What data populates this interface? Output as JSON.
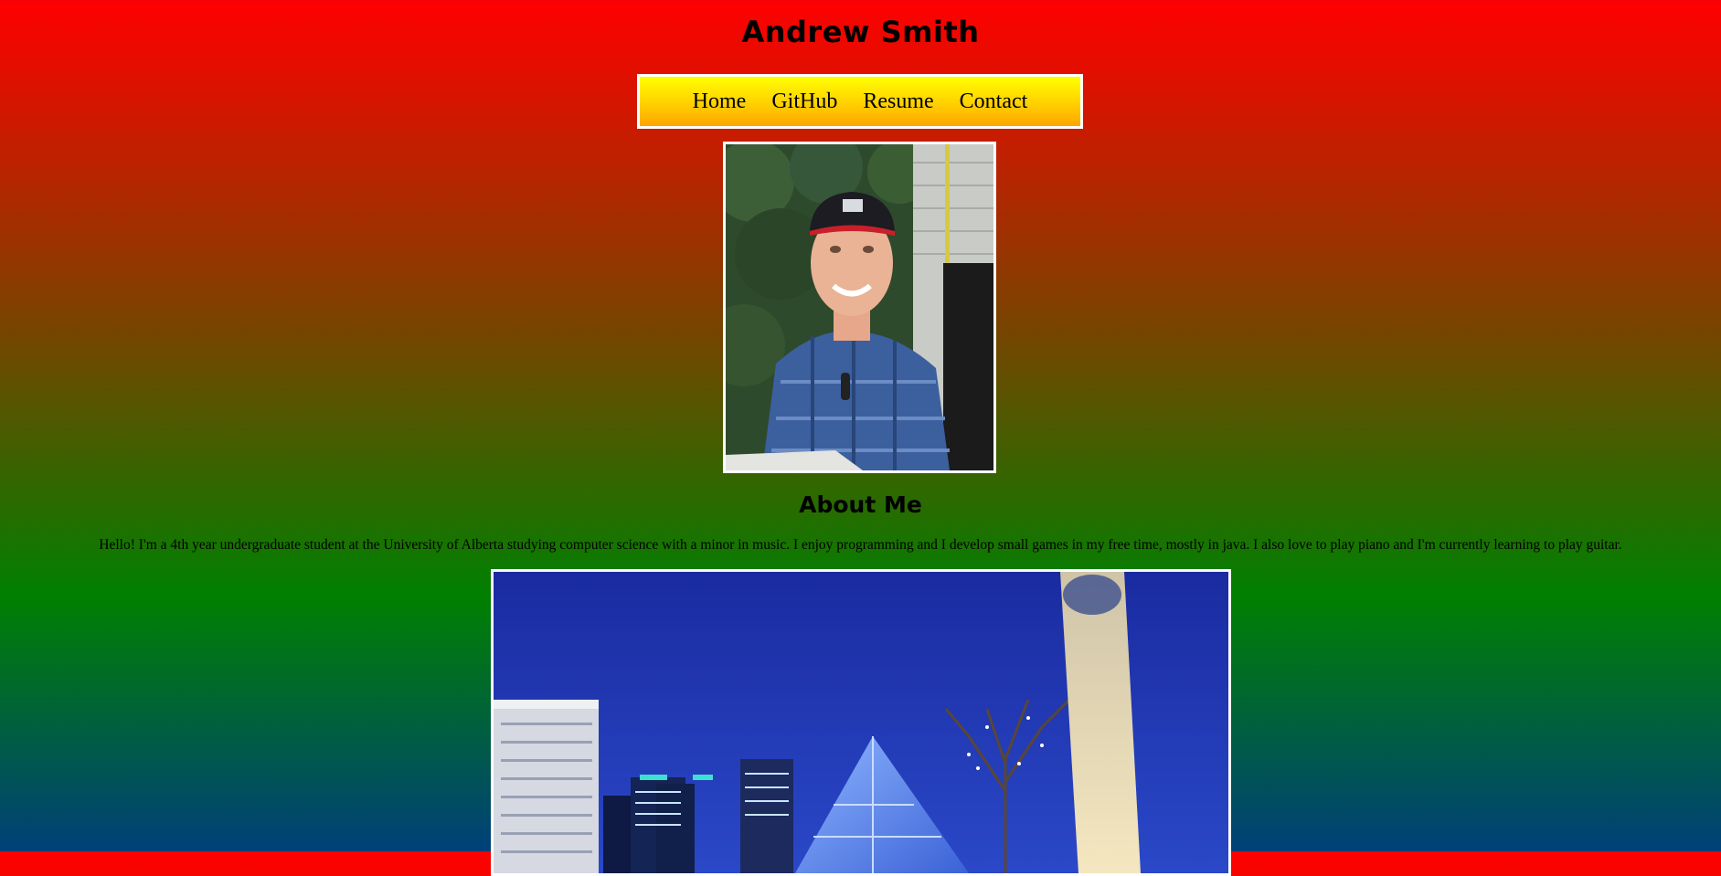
{
  "header": {
    "title": "Andrew Smith"
  },
  "nav": {
    "items": [
      {
        "label": "Home"
      },
      {
        "label": "GitHub"
      },
      {
        "label": "Resume"
      },
      {
        "label": "Contact"
      }
    ]
  },
  "about": {
    "heading": "About Me",
    "text": "Hello! I'm a 4th year undergraduate student at the University of Alberta studying computer science with a minor in music. I enjoy programming and I develop small games in my free time, mostly in java. I also love to play piano and I'm currently learning to play guitar."
  },
  "colors": {
    "background_top": "#ff0000",
    "background_mid": "#008000",
    "background_bottom": "#00407a",
    "nav_top": "#ffff00",
    "nav_bottom": "#ffa500",
    "border": "#ffffff"
  }
}
